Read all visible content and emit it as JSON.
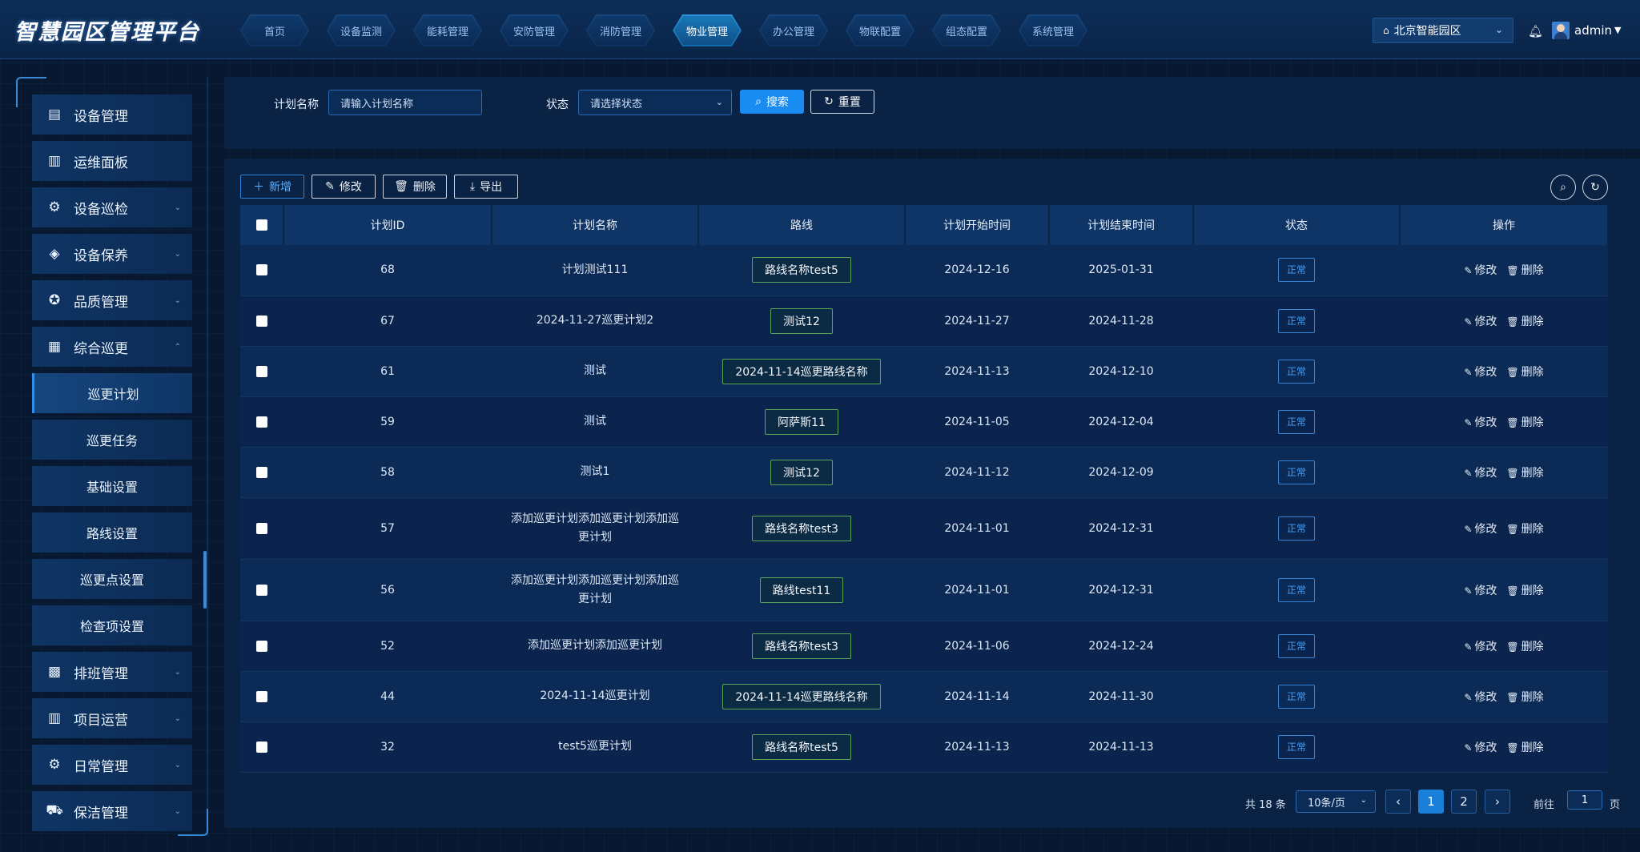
{
  "app": {
    "title": "智慧园区管理平台"
  },
  "nav": [
    {
      "label": "首页"
    },
    {
      "label": "设备监测"
    },
    {
      "label": "能耗管理"
    },
    {
      "label": "安防管理"
    },
    {
      "label": "消防管理"
    },
    {
      "label": "物业管理",
      "active": true
    },
    {
      "label": "办公管理"
    },
    {
      "label": "物联配置"
    },
    {
      "label": "组态配置"
    },
    {
      "label": "系统管理"
    }
  ],
  "header": {
    "park": "北京智能园区",
    "user": "admin"
  },
  "sidebar": {
    "items": [
      {
        "label": "设备管理",
        "icon": "server-icon",
        "chevron": ""
      },
      {
        "label": "运维面板",
        "icon": "chart-icon",
        "chevron": ""
      },
      {
        "label": "设备巡检",
        "icon": "settings-icon",
        "chevron": "⌄"
      },
      {
        "label": "设备保养",
        "icon": "tag-icon",
        "chevron": "⌄"
      },
      {
        "label": "品质管理",
        "icon": "badge-icon",
        "chevron": "⌄"
      },
      {
        "label": "综合巡更",
        "icon": "building-icon",
        "chevron": "⌃"
      }
    ],
    "sub_items": [
      {
        "label": "巡更计划",
        "active": true
      },
      {
        "label": "巡更任务"
      },
      {
        "label": "基础设置"
      },
      {
        "label": "路线设置"
      },
      {
        "label": "巡更点设置"
      },
      {
        "label": "检查项设置"
      }
    ],
    "more_items": [
      {
        "label": "排班管理",
        "icon": "calendar-icon"
      },
      {
        "label": "项目运营",
        "icon": "chart-icon"
      },
      {
        "label": "日常管理",
        "icon": "settings-icon"
      },
      {
        "label": "保洁管理",
        "icon": "cart-icon"
      }
    ]
  },
  "search": {
    "plan_name_label": "计划名称",
    "plan_name_placeholder": "请输入计划名称",
    "status_label": "状态",
    "status_placeholder": "请选择状态",
    "search_button": "搜索",
    "reset_button": "重置"
  },
  "toolbar": {
    "add": "新增",
    "edit": "修改",
    "delete": "删除",
    "export": "导出"
  },
  "table": {
    "columns": [
      "计划ID",
      "计划名称",
      "路线",
      "计划开始时间",
      "计划结束时间",
      "状态",
      "操作"
    ],
    "rows": [
      {
        "id": "68",
        "name": "计划测试111",
        "route": "路线名称test5",
        "start": "2024-12-16",
        "end": "2025-01-31",
        "status": "正常"
      },
      {
        "id": "67",
        "name": "2024-11-27巡更计划2",
        "route": "测试12",
        "start": "2024-11-27",
        "end": "2024-11-28",
        "status": "正常"
      },
      {
        "id": "61",
        "name": "测试",
        "route": "2024-11-14巡更路线名称",
        "start": "2024-11-13",
        "end": "2024-12-10",
        "status": "正常"
      },
      {
        "id": "59",
        "name": "测试",
        "route": "阿萨斯11",
        "start": "2024-11-05",
        "end": "2024-12-04",
        "status": "正常"
      },
      {
        "id": "58",
        "name": "测试1",
        "route": "测试12",
        "start": "2024-11-12",
        "end": "2024-12-09",
        "status": "正常"
      },
      {
        "id": "57",
        "name": "添加巡更计划添加巡更计划添加巡更计划",
        "route": "路线名称test3",
        "start": "2024-11-01",
        "end": "2024-12-31",
        "status": "正常"
      },
      {
        "id": "56",
        "name": "添加巡更计划添加巡更计划添加巡更计划",
        "route": "路线test11",
        "start": "2024-11-01",
        "end": "2024-12-31",
        "status": "正常"
      },
      {
        "id": "52",
        "name": "添加巡更计划添加巡更计划",
        "route": "路线名称test3",
        "start": "2024-11-06",
        "end": "2024-12-24",
        "status": "正常"
      },
      {
        "id": "44",
        "name": "2024-11-14巡更计划",
        "route": "2024-11-14巡更路线名称",
        "start": "2024-11-14",
        "end": "2024-11-30",
        "status": "正常"
      },
      {
        "id": "32",
        "name": "test5巡更计划",
        "route": "路线名称test5",
        "start": "2024-11-13",
        "end": "2024-11-13",
        "status": "正常"
      }
    ],
    "op_edit": "修改",
    "op_delete": "删除"
  },
  "pagination": {
    "total": "共 18 条",
    "page_size": "10条/页",
    "pages": [
      "1",
      "2"
    ],
    "current": "1",
    "goto_label": "前往",
    "goto_value": "1",
    "goto_unit": "页"
  },
  "colors": {
    "accent": "#1a8bf0",
    "route_border": "#5aa45a",
    "status": "#3ea0ff"
  }
}
